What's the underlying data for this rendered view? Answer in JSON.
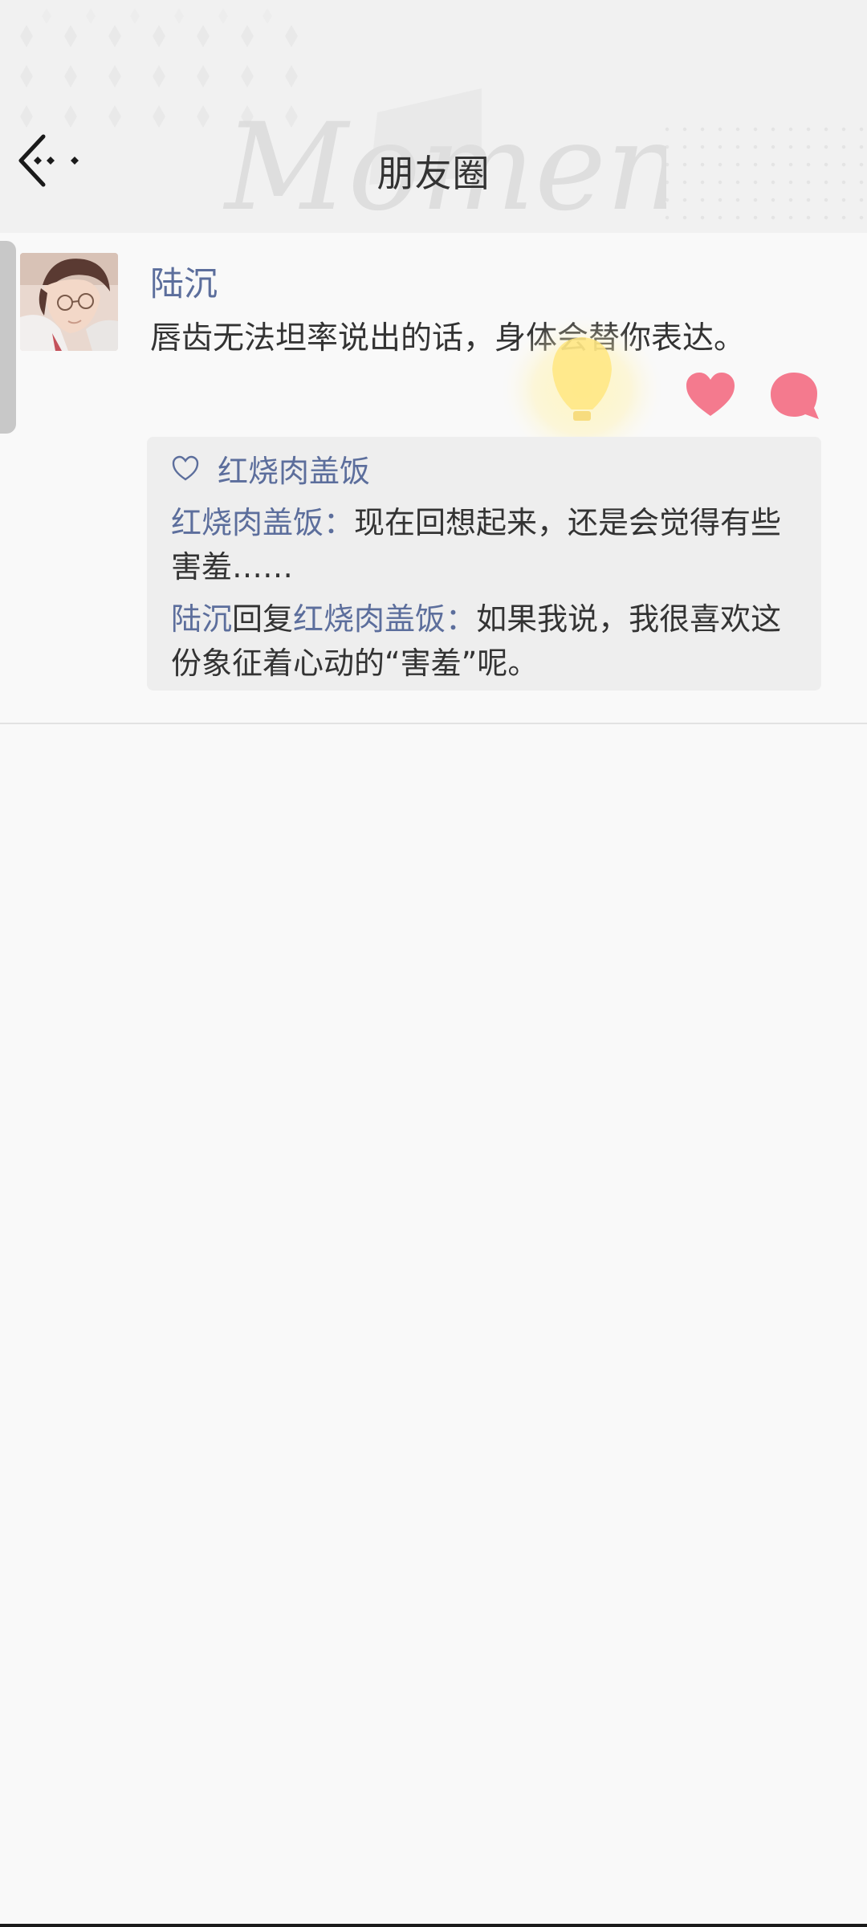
{
  "header": {
    "title": "朋友圈",
    "watermark": "Moments",
    "back_icon": "back-arrow-icon"
  },
  "post": {
    "author": "陆沉",
    "text": "唇齿无法坦率说出的话，身体会替你表达。",
    "actions": {
      "like_icon": "heart-icon",
      "comment_icon": "comment-bubble-icon",
      "like_color": "#f47a8e",
      "comment_color": "#f47a8e"
    },
    "likes": {
      "icon": "heart-outline-icon",
      "names": "红烧肉盖饭"
    },
    "comments": [
      {
        "author": "红烧肉盖饭",
        "separator": "：",
        "text": "现在回想起来，还是会觉得有些害羞……"
      },
      {
        "author": "陆沉",
        "reply_word": "回复",
        "reply_to": "红烧肉盖饭",
        "separator": "：",
        "text": "如果我说，我很喜欢这份象征着心动的“害羞”呢。"
      }
    ]
  },
  "colors": {
    "accent_name": "#5c6e9c",
    "background": "#f9f9f9",
    "header_bg": "#f1f1f1"
  }
}
